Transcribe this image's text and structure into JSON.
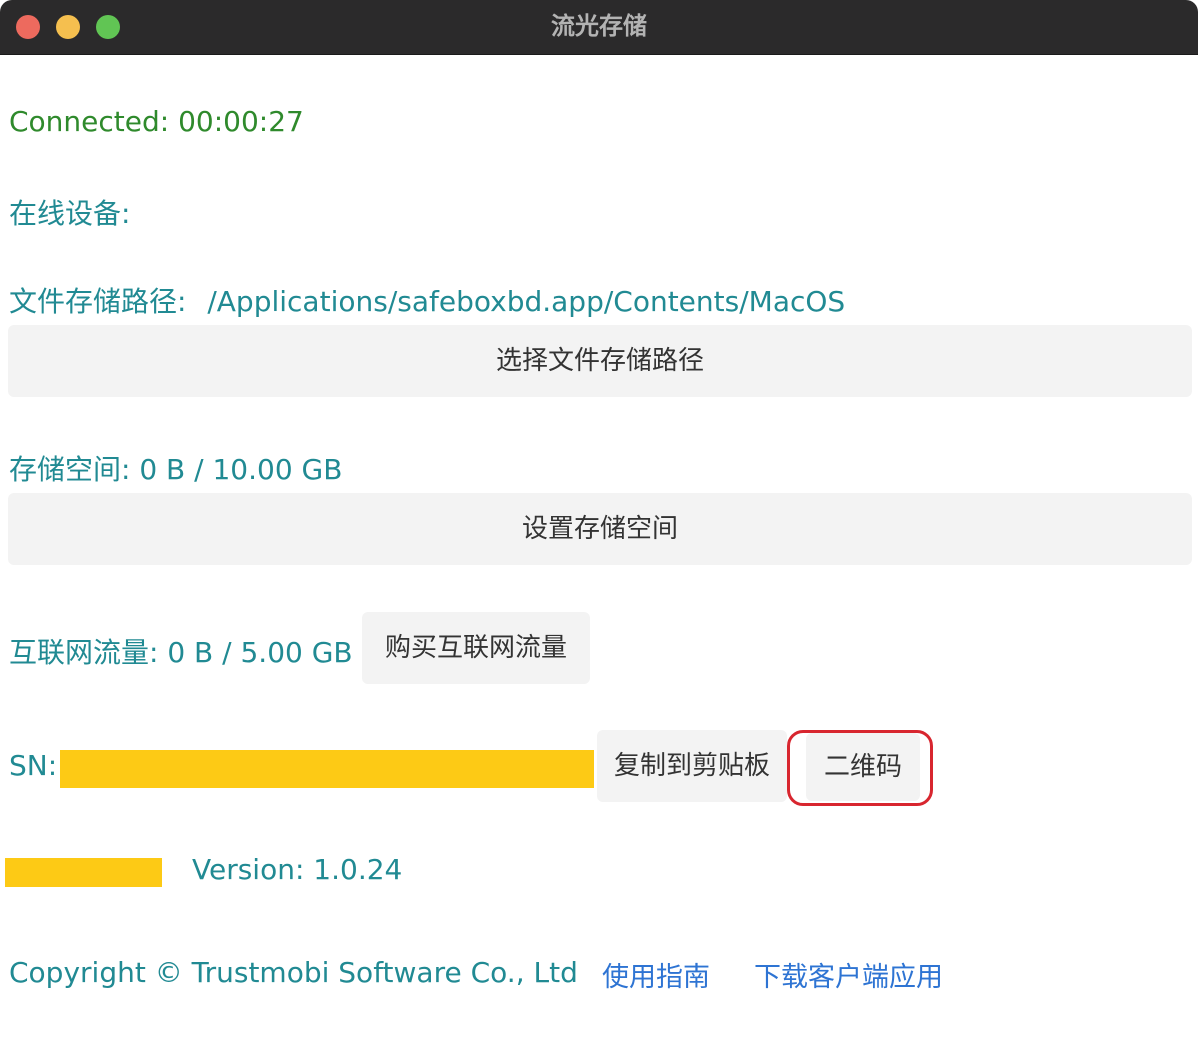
{
  "window": {
    "title": "流光存储",
    "controls": {
      "close": "close-button",
      "minimize": "minimize-button",
      "maximize": "maximize-button"
    }
  },
  "status": {
    "connected": "Connected: 00:00:27"
  },
  "devices": {
    "label": "在线设备:"
  },
  "storage_path": {
    "label": "文件存储路径:",
    "value": "/Applications/safeboxbd.app/Contents/MacOS",
    "button_label": "选择文件存储路径"
  },
  "storage_space": {
    "text": "存储空间: 0 B / 10.00 GB",
    "button_label": "设置存储空间"
  },
  "traffic": {
    "text": "互联网流量: 0 B / 5.00 GB",
    "button_label": "购买互联网流量"
  },
  "sn": {
    "label": "SN:",
    "copy_label": "复制到剪贴板",
    "qr_label": "二维码"
  },
  "version": {
    "text": "Version: 1.0.24"
  },
  "footer": {
    "copyright": "Copyright © Trustmobi Software Co., Ltd",
    "guide_link": "使用指南",
    "download_link": "下载客户端应用"
  },
  "colors": {
    "accent_teal": "#218a93",
    "connected_green": "#2f8a2c",
    "link_blue": "#2e74d3",
    "redaction_yellow": "#fdca15",
    "highlight_red": "#d8262f"
  }
}
